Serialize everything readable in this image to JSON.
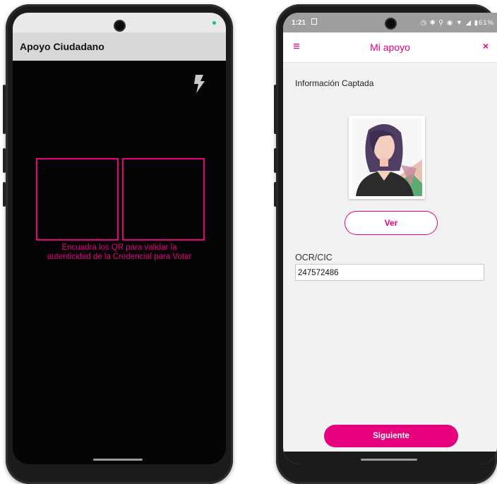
{
  "screen1": {
    "app_title": "Apoyo Ciudadano",
    "instruction_line1": "Encuadra los QR para validar la",
    "instruction_line2": "autenticidad de la Credencial para Votar",
    "flash_icon": "flash-icon",
    "accent_color": "#e6007e"
  },
  "screen2": {
    "status_time": "1:21",
    "battery_percent": "61%",
    "header_title": "Mi apoyo",
    "menu_icon": "menu-icon",
    "close_icon": "close-icon",
    "section_label": "Información Captada",
    "view_button": "Ver",
    "ocr_label": "OCR/CIC",
    "ocr_value": "247572486",
    "next_button": "Siguiente",
    "accent_color": "#e6007e"
  }
}
